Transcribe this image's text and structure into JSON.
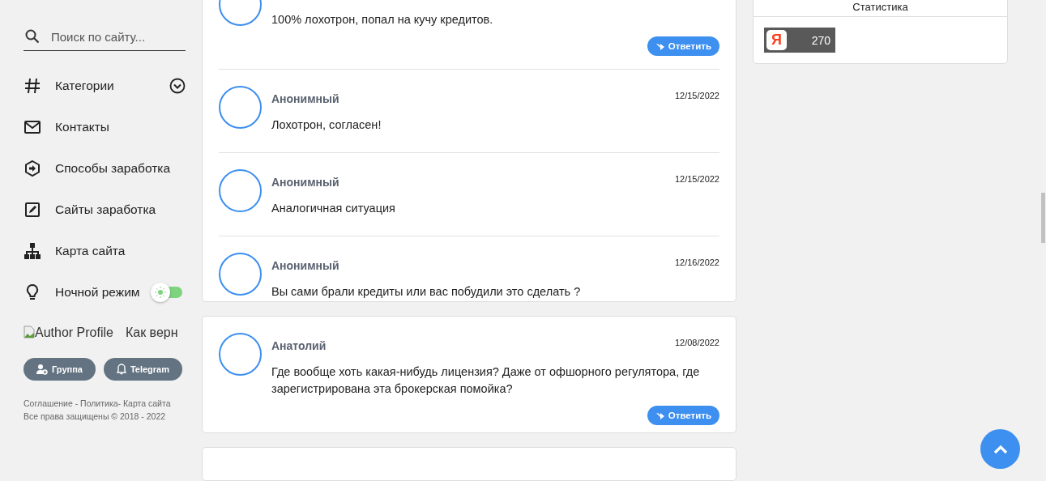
{
  "sidebar": {
    "search": {
      "placeholder": "Поиск по сайту..."
    },
    "items": [
      {
        "label": "Категории"
      },
      {
        "label": "Контакты"
      },
      {
        "label": "Способы заработка"
      },
      {
        "label": "Сайты заработка"
      },
      {
        "label": "Карта сайта"
      },
      {
        "label": "Ночной режим",
        "toggle": {
          "on": false
        }
      }
    ],
    "author": {
      "alt": "Author Profile",
      "text": "Как верн"
    },
    "buttons": [
      {
        "label": "Группа"
      },
      {
        "label": "Telegram"
      }
    ],
    "footer": {
      "links": "Соглашение - Политика- Карта сайта",
      "copyright": "Все права защищены © 2018 - 2022"
    }
  },
  "comment_cards": [
    {
      "comments": [
        {
          "text": "100% лохотрон, попал на кучу кредитов.",
          "reply": "Ответить"
        },
        {
          "author": "Анонимный",
          "date": "12/15/2022",
          "text": "Лохотрон, согласен!"
        },
        {
          "author": "Анонимный",
          "date": "12/15/2022",
          "text": "Аналогичная ситуация"
        },
        {
          "author": "Анонимный",
          "date": "12/16/2022",
          "text": "Вы сами брали кредиты или вас побудили это сделать ?"
        }
      ]
    },
    {
      "comments": [
        {
          "author": "Анатолий",
          "date": "12/08/2022",
          "text": "Где вообще хоть какая-нибудь лицензия? Даже от офшорного регулятора, где зарегистрирована эта брокерская помойка?",
          "reply": "Ответить"
        }
      ]
    }
  ],
  "stats_widget": {
    "title": "Статистика",
    "counter": {
      "logo": "Я",
      "value": "270"
    }
  }
}
